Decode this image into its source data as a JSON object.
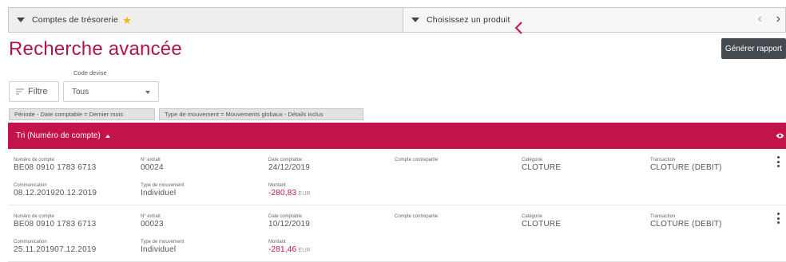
{
  "topbar": {
    "accounts_dropdown": "Comptes de trésorerie",
    "product_dropdown": "Choisissez un produit"
  },
  "header": {
    "title": "Recherche avancée",
    "generate_button": "Générer rapport"
  },
  "filters": {
    "filter_button": "Filtre",
    "currency_label": "Code devise",
    "currency_value": "Tous",
    "chips": [
      "Période - Date comptable = Dernier mois",
      "Type de mouvement = Mouvements globaux - Détails inclus"
    ]
  },
  "sort": {
    "label": "Tri (Numéro de compte)"
  },
  "columns": {
    "account_number": "Numéro de compte",
    "statement_no": "N° extrait",
    "booking_date": "Date comptable",
    "counterparty": "Compte contrepartie",
    "category": "Catégorie",
    "transaction": "Transaction",
    "communication": "Communication",
    "movement_type": "Type de mouvement",
    "amount": "Montant"
  },
  "rows": [
    {
      "account_number": "BE08 0910 1783 6713",
      "statement_no": "00024",
      "booking_date": "24/12/2019",
      "counterparty": "",
      "category": "CLOTURE",
      "transaction": "CLOTURE (DEBIT)",
      "communication": "08.12.201920.12.2019",
      "movement_type": "Individuel",
      "amount": "-280,83",
      "currency": "EUR"
    },
    {
      "account_number": "BE08 0910 1783 6713",
      "statement_no": "00023",
      "booking_date": "10/12/2019",
      "counterparty": "",
      "category": "CLOTURE",
      "transaction": "CLOTURE (DEBIT)",
      "communication": "25.11.201907.12.2019",
      "movement_type": "Individuel",
      "amount": "-281,46",
      "currency": "EUR"
    }
  ],
  "colors": {
    "brand": "#c4124a",
    "title": "#b2124a",
    "button_dark": "#444b50",
    "star": "#f2b705"
  },
  "icons": [
    "caret-down-icon",
    "star-icon",
    "chevron-left-icon",
    "chevron-right-icon",
    "filter-icon",
    "eye-icon",
    "kebab-menu-icon"
  ]
}
